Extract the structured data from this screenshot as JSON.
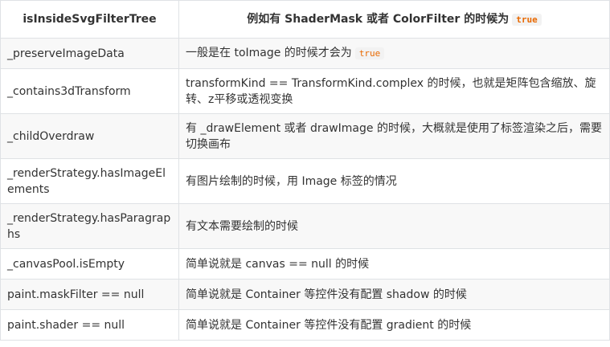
{
  "table": {
    "header": {
      "col1": "isInsideSvgFilterTree",
      "col2_text": "例如有 ShaderMask 或者 ColorFilter 的时候为",
      "col2_code": "true"
    },
    "rows": [
      {
        "name": "_preserveImageData",
        "desc": "一般是在 toImage 的时候才会为",
        "code": "true"
      },
      {
        "name": "_contains3dTransform",
        "desc": "transformKind == TransformKind.complex 的时候，也就是矩阵包含缩放、旋转、z平移或透视变换"
      },
      {
        "name": "_childOverdraw",
        "desc": "有 _drawElement 或者 drawImage 的时候，大概就是使用了标签渲染之后，需要切换画布"
      },
      {
        "name": "_renderStrategy.hasImageElements",
        "desc": "有图片绘制的时候，用 Image 标签的情况"
      },
      {
        "name": "_renderStrategy.hasParagraphs",
        "desc": "有文本需要绘制的时候"
      },
      {
        "name": "_canvasPool.isEmpty",
        "desc": "简单说就是 canvas == null 的时候"
      },
      {
        "name": "paint.maskFilter == null",
        "desc": "简单说就是 Container 等控件没有配置 shadow 的时候"
      },
      {
        "name": "paint.shader == null",
        "desc": "简单说就是 Container 等控件没有配置 gradient 的时候"
      }
    ]
  }
}
